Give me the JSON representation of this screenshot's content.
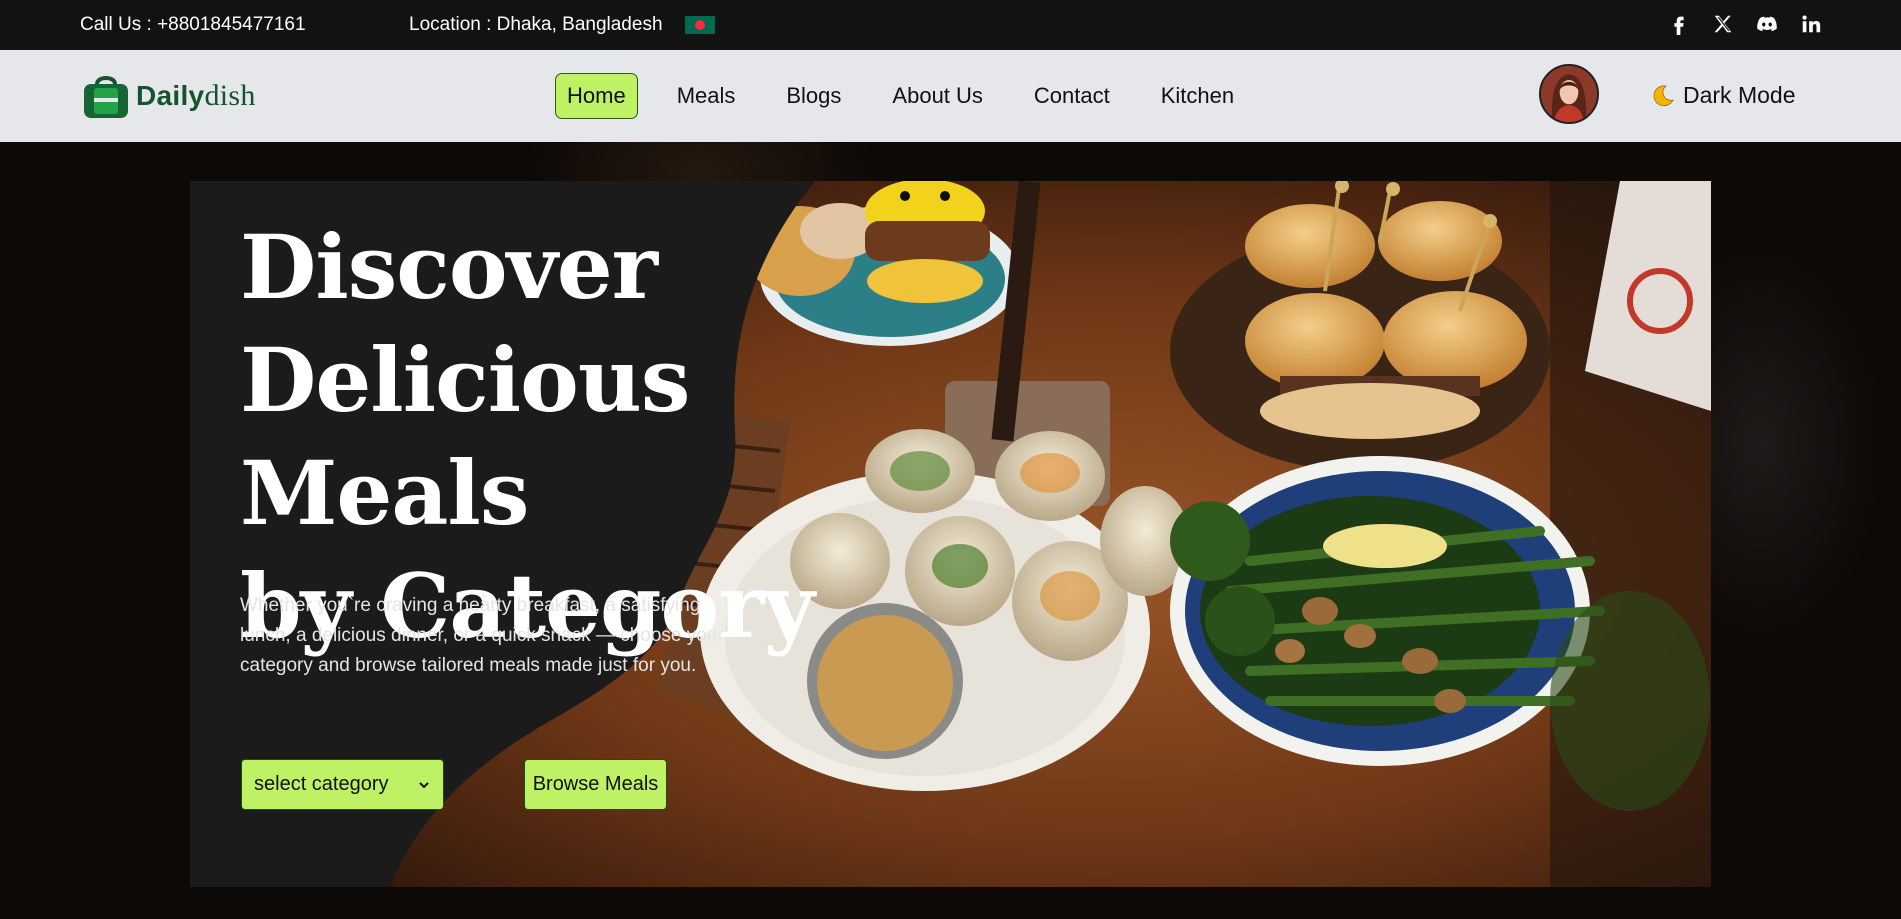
{
  "topbar": {
    "phone": "Call Us : +8801845477161",
    "location": "Location : Dhaka, Bangladesh",
    "flag_icon": "bangladesh-flag-icon",
    "socials": [
      "facebook-icon",
      "x-icon",
      "discord-icon",
      "linkedin-icon"
    ]
  },
  "nav": {
    "logo_icon": "shopping-bag-icon",
    "logo_bold": "Daily",
    "logo_rest": "dish",
    "links": [
      "Home",
      "Meals",
      "Blogs",
      "About Us",
      "Contact",
      "Kitchen"
    ],
    "active": "Home",
    "dark_mode_label": "Dark Mode",
    "dark_mode_icon": "moon-icon"
  },
  "hero": {
    "title_line1": "Discover",
    "title_line2": "Delicious Meals",
    "title_line3": "by Category",
    "description": "Whether you`re craving a hearty breakfast, a satisfying lunch, a delicious dinner, or a quick snack — choose your category and browse tailored meals made just for you.",
    "select_placeholder": "select category",
    "browse_label": "Browse Meals"
  },
  "colors": {
    "accent": "#bef264",
    "brand_green": "#14532d",
    "topbar_bg": "#121212",
    "nav_bg": "#e5e7eb",
    "card_bg": "#1b1b1b"
  }
}
